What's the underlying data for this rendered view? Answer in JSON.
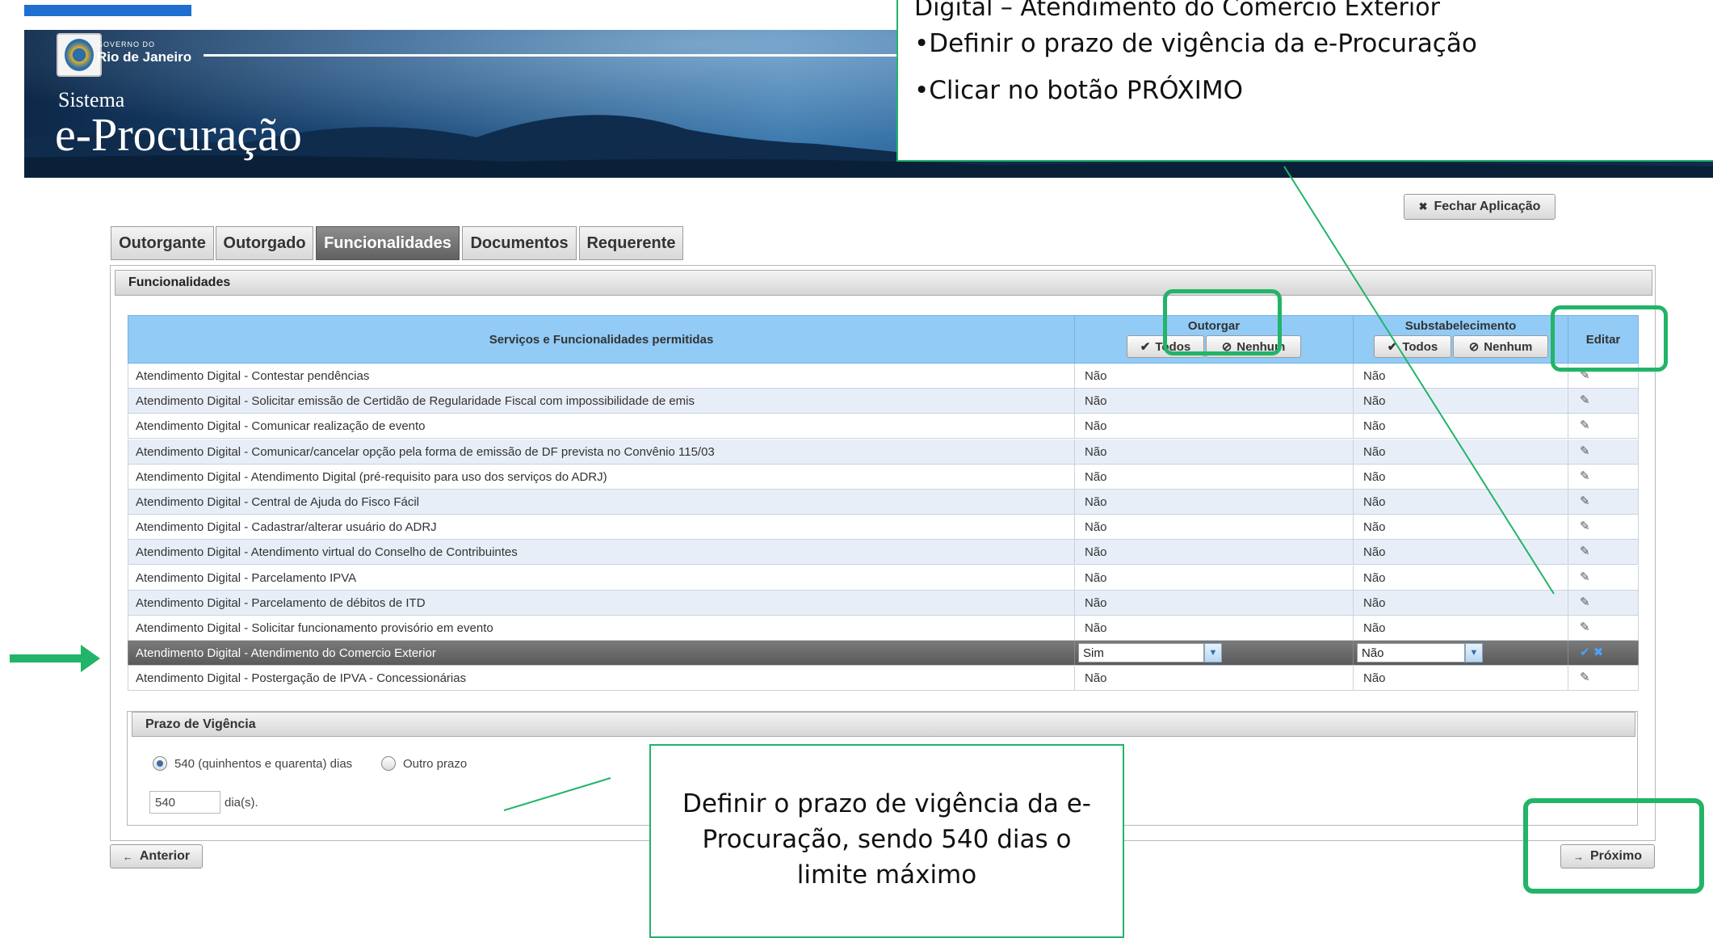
{
  "banner": {
    "gov_small": "GOVERNO DO",
    "gov_big": "Rio de Janeiro",
    "system_small": "Sistema",
    "system_big": "e-Procuração"
  },
  "header": {
    "close_app": "Fechar Aplicação"
  },
  "tabs": [
    {
      "label": "Outorgante",
      "active": false
    },
    {
      "label": "Outorgado",
      "active": false
    },
    {
      "label": "Funcionalidades",
      "active": true
    },
    {
      "label": "Documentos",
      "active": false
    },
    {
      "label": "Requerente",
      "active": false
    }
  ],
  "section_title": "Funcionalidades",
  "table": {
    "col_services": "Serviços e Funcionalidades permitidas",
    "col_outorgar": "Outorgar",
    "col_substabelecimento": "Substabelecimento",
    "col_editar": "Editar",
    "btn_todos": "Todos",
    "btn_nenhum": "Nenhum",
    "rows": [
      {
        "name": "Atendimento Digital - Contestar pendências",
        "outorgar": "Não",
        "subst": "Não"
      },
      {
        "name": "Atendimento Digital - Solicitar emissão de Certidão de Regularidade Fiscal com impossibilidade de emis",
        "outorgar": "Não",
        "subst": "Não"
      },
      {
        "name": "Atendimento Digital - Comunicar realização de evento",
        "outorgar": "Não",
        "subst": "Não"
      },
      {
        "name": "Atendimento Digital - Comunicar/cancelar opção pela forma de emissão de DF prevista no Convênio 115/03",
        "outorgar": "Não",
        "subst": "Não"
      },
      {
        "name": "Atendimento Digital - Atendimento Digital (pré-requisito para uso dos serviços do ADRJ)",
        "outorgar": "Não",
        "subst": "Não"
      },
      {
        "name": "Atendimento Digital - Central de Ajuda do Fisco Fácil",
        "outorgar": "Não",
        "subst": "Não"
      },
      {
        "name": "Atendimento Digital - Cadastrar/alterar usuário do ADRJ",
        "outorgar": "Não",
        "subst": "Não"
      },
      {
        "name": "Atendimento Digital - Atendimento virtual do Conselho de Contribuintes",
        "outorgar": "Não",
        "subst": "Não"
      },
      {
        "name": "Atendimento Digital - Parcelamento IPVA",
        "outorgar": "Não",
        "subst": "Não"
      },
      {
        "name": "Atendimento Digital - Parcelamento de débitos de ITD",
        "outorgar": "Não",
        "subst": "Não"
      },
      {
        "name": "Atendimento Digital - Solicitar funcionamento provisório em evento",
        "outorgar": "Não",
        "subst": "Não"
      },
      {
        "name": "Atendimento Digital - Atendimento do Comercio Exterior",
        "outorgar": "Sim",
        "subst": "Não",
        "selected": true
      },
      {
        "name": "Atendimento Digital - Postergação de IPVA - Concessionárias",
        "outorgar": "Não",
        "subst": "Não"
      }
    ]
  },
  "vigencia": {
    "title": "Prazo de Vigência",
    "option_default": "540 (quinhentos e quarenta) dias",
    "option_other": "Outro prazo",
    "days_value": "540",
    "days_unit": "dia(s)."
  },
  "nav": {
    "prev": "Anterior",
    "next": "Próximo"
  },
  "annotations": {
    "top_line1": "Digital – Atendimento do Comercio Exterior",
    "top_line2": "•Definir o prazo de vigência da e-Procuração",
    "top_line3": "•Clicar no botão PRÓXIMO",
    "bottom_text": "Definir o prazo de vigência da e-Procuração, sendo 540 dias o limite máximo"
  },
  "colors": {
    "accent_green": "#22b468",
    "header_blue": "#91cbf6",
    "topline_blue": "#1e6fcf"
  }
}
